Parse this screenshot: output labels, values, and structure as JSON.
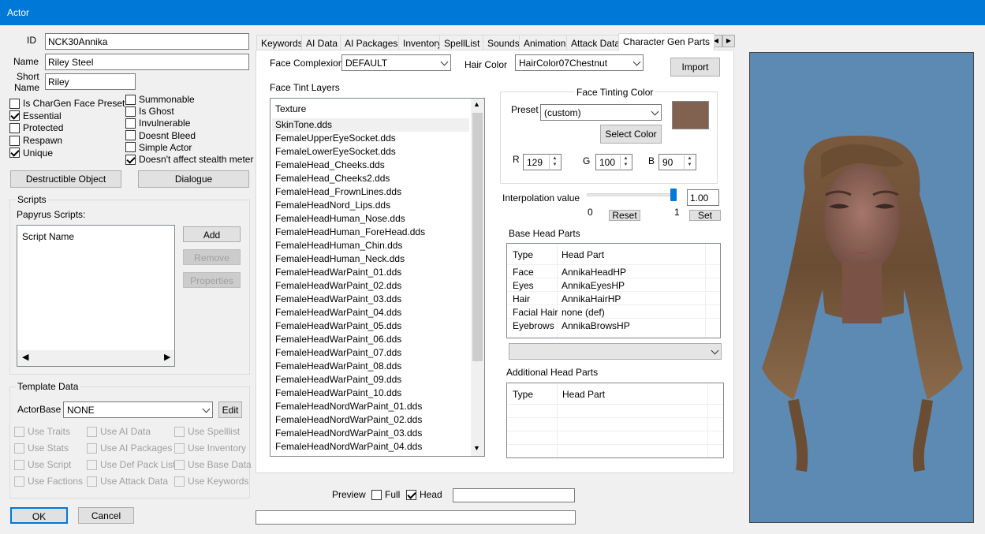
{
  "window": {
    "title": "Actor"
  },
  "identity": {
    "id_label": "ID",
    "id_value": "NCK30Annika",
    "name_label": "Name",
    "name_value": "Riley Steel",
    "short_label_1": "Short",
    "short_label_2": "Name",
    "short_value": "Riley"
  },
  "flags_left": [
    {
      "label": "Is CharGen Face Preset",
      "checked": false
    },
    {
      "label": "Essential",
      "checked": true
    },
    {
      "label": "Protected",
      "checked": false
    },
    {
      "label": "Respawn",
      "checked": false
    },
    {
      "label": "Unique",
      "checked": true
    }
  ],
  "flags_right": [
    {
      "label": "Summonable",
      "checked": false
    },
    {
      "label": "Is Ghost",
      "checked": false
    },
    {
      "label": "Invulnerable",
      "checked": false
    },
    {
      "label": "Doesnt Bleed",
      "checked": false
    },
    {
      "label": "Simple Actor",
      "checked": false
    },
    {
      "label": "Doesn't affect stealth meter",
      "checked": true
    }
  ],
  "buttons": {
    "destructible": "Destructible Object",
    "dialogue": "Dialogue",
    "add": "Add",
    "remove": "Remove",
    "properties": "Properties",
    "edit": "Edit",
    "ok": "OK",
    "cancel": "Cancel",
    "import": "Import",
    "select_color": "Select Color",
    "reset": "Reset",
    "set": "Set"
  },
  "scripts": {
    "group_label": "Scripts",
    "papyrus_label": "Papyrus Scripts:",
    "column": "Script Name"
  },
  "template": {
    "group_label": "Template Data",
    "actorbase_label": "ActorBase",
    "actorbase_value": "NONE",
    "options": [
      [
        "Use Traits",
        "Use AI Data",
        "Use Spelllist"
      ],
      [
        "Use Stats",
        "Use AI Packages",
        "Use Inventory"
      ],
      [
        "Use Script",
        "Use Def Pack List",
        "Use Base Data"
      ],
      [
        "Use Factions",
        "Use Attack Data",
        "Use Keywords"
      ]
    ]
  },
  "tabs": [
    "Keywords",
    "AI Data",
    "AI Packages",
    "Inventory",
    "SpellList",
    "Sounds",
    "Animation",
    "Attack Data",
    "Character Gen Parts"
  ],
  "chargen": {
    "complexion_label": "Face Complexion",
    "complexion_value": "DEFAULT",
    "hair_label": "Hair Color",
    "hair_value": "HairColor07Chestnut",
    "tint_layers_label": "Face Tint Layers",
    "texture_column": "Texture",
    "textures": [
      "SkinTone.dds",
      "FemaleUpperEyeSocket.dds",
      "FemaleLowerEyeSocket.dds",
      "FemaleHead_Cheeks.dds",
      "FemaleHead_Cheeks2.dds",
      "FemaleHead_FrownLines.dds",
      "FemaleHeadNord_Lips.dds",
      "FemaleHeadHuman_Nose.dds",
      "FemaleHeadHuman_ForeHead.dds",
      "FemaleHeadHuman_Chin.dds",
      "FemaleHeadHuman_Neck.dds",
      "FemaleHeadWarPaint_01.dds",
      "FemaleHeadWarPaint_02.dds",
      "FemaleHeadWarPaint_03.dds",
      "FemaleHeadWarPaint_04.dds",
      "FemaleHeadWarPaint_05.dds",
      "FemaleHeadWarPaint_06.dds",
      "FemaleHeadWarPaint_07.dds",
      "FemaleHeadWarPaint_08.dds",
      "FemaleHeadWarPaint_09.dds",
      "FemaleHeadWarPaint_10.dds",
      "FemaleHeadNordWarPaint_01.dds",
      "FemaleHeadNordWarPaint_02.dds",
      "FemaleHeadNordWarPaint_03.dds",
      "FemaleHeadNordWarPaint_04.dds"
    ],
    "tint_group_label": "Face Tinting Color",
    "preset_label": "Preset",
    "preset_value": "(custom)",
    "swatch_color": "#81614f",
    "r_label": "R",
    "r_value": "129",
    "g_label": "G",
    "g_value": "100",
    "b_label": "B",
    "b_value": "90",
    "interp_label": "Interpolation value",
    "interp_value": "1.00",
    "interp_level": 1.0,
    "slider_min": "0",
    "slider_max": "1",
    "base_head_label": "Base Head Parts",
    "head_columns": [
      "Type",
      "Head Part"
    ],
    "head_parts": [
      [
        "Face",
        "AnnikaHeadHP"
      ],
      [
        "Eyes",
        "AnnikaEyesHP"
      ],
      [
        "Hair",
        "AnnikaHairHP"
      ],
      [
        "Facial Hair",
        "none (def)"
      ],
      [
        "Eyebrows",
        "AnnikaBrowsHP"
      ]
    ],
    "additional_label": "Additional Head Parts"
  },
  "preview": {
    "label": "Preview",
    "full_label": "Full",
    "full_checked": false,
    "head_label": "Head",
    "head_checked": true,
    "bg_color": "#5d8ab3"
  }
}
